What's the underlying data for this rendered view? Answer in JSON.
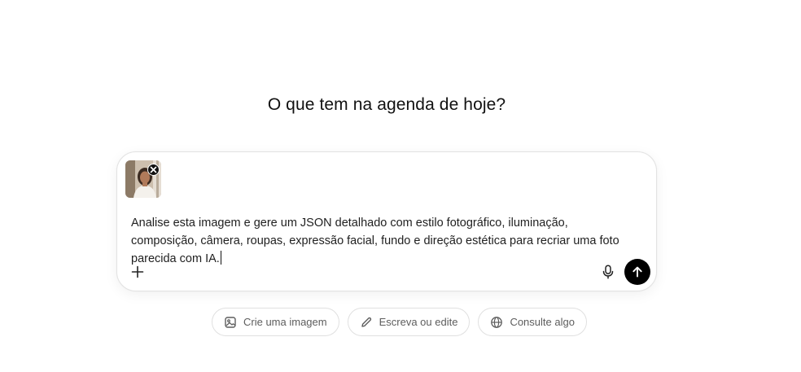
{
  "headline": "O que tem na agenda de hoje?",
  "composer": {
    "attachment": {
      "kind": "image-thumbnail",
      "icon": "close-icon"
    },
    "prompt_text": "Analise esta imagem e gere um JSON detalhado com estilo fotográfico, iluminação, composição, câmera, roupas, expressão facial, fundo e direção estética para recriar uma foto parecida com IA.",
    "icons": {
      "add": "plus-icon",
      "voice": "microphone-icon",
      "send": "arrow-up-icon"
    },
    "colors": {
      "send_bg": "#000000",
      "border": "#e3e3e3"
    }
  },
  "suggestions": [
    {
      "label": "Crie uma imagem",
      "icon": "image-icon"
    },
    {
      "label": "Escreva ou edite",
      "icon": "pencil-icon"
    },
    {
      "label": "Consulte algo",
      "icon": "globe-icon"
    }
  ]
}
